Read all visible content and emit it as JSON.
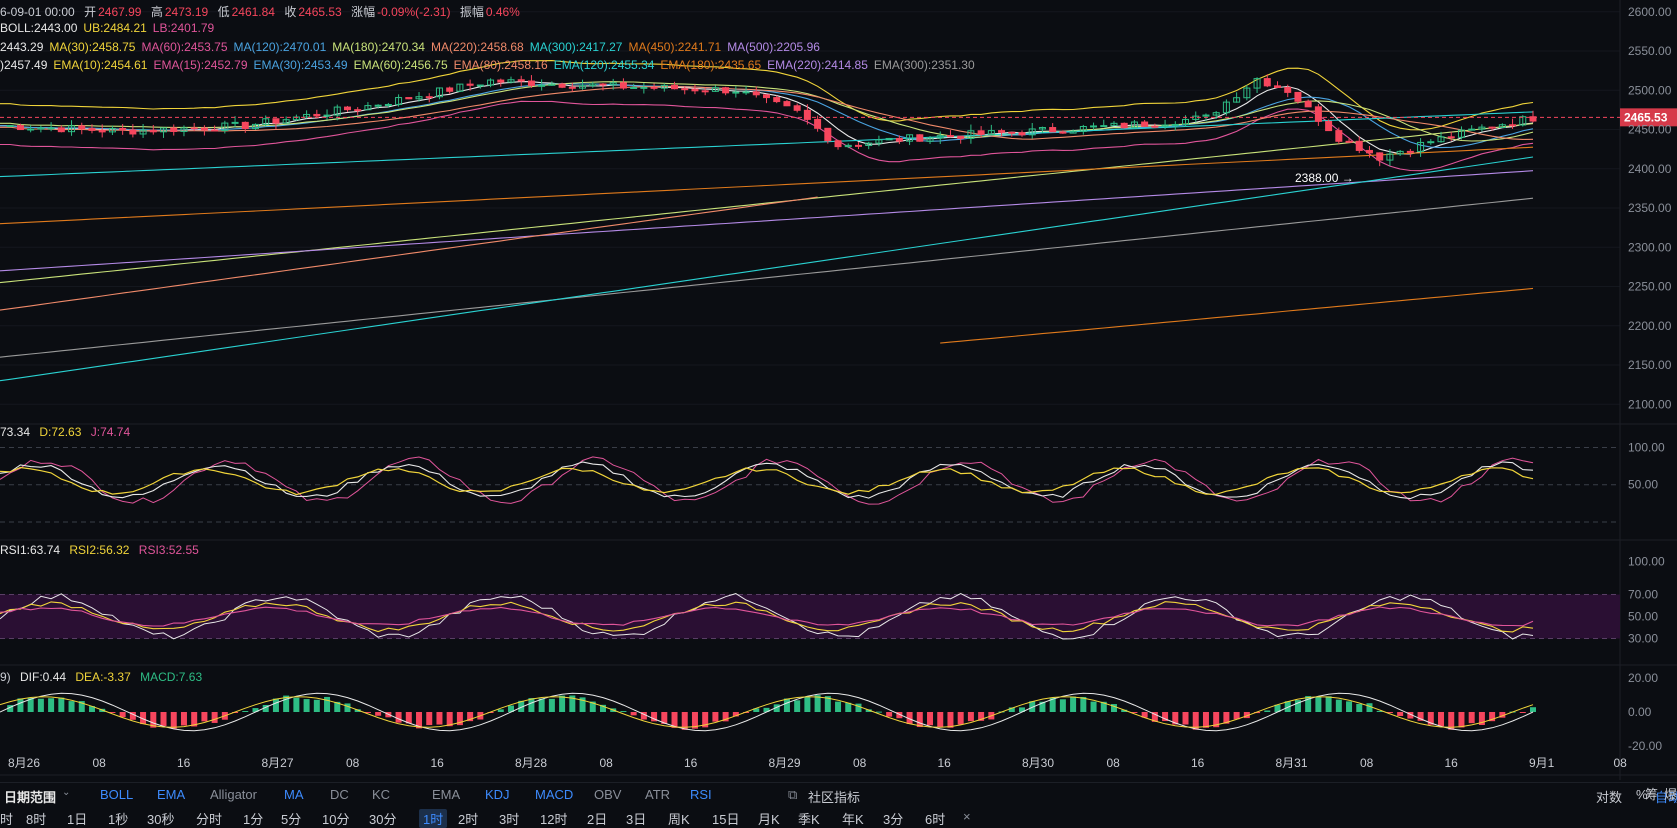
{
  "header": {
    "date": "6-09-01 00:00",
    "open_label": "开",
    "open": "2467.99",
    "high_label": "高",
    "high": "2473.19",
    "low_label": "低",
    "low": "2461.84",
    "close_label": "收",
    "close": "2465.53",
    "change_label": "涨幅",
    "change": "-0.09%(-2.31)",
    "amp_label": "振幅",
    "amp": "0.46%"
  },
  "boll_line": [
    {
      "text": "BOLL:2443.00",
      "color": "#e8e8e8"
    },
    {
      "text": "UB:2484.21",
      "color": "#f0d43a"
    },
    {
      "text": "LB:2401.79",
      "color": "#e0559a"
    }
  ],
  "ma_line": [
    {
      "text": "2443.29",
      "color": "#e8e8e8"
    },
    {
      "text": "MA(30):2458.75",
      "color": "#f0d43a"
    },
    {
      "text": "MA(60):2453.75",
      "color": "#e0559a"
    },
    {
      "text": "MA(120):2470.01",
      "color": "#4aa3e0"
    },
    {
      "text": "MA(180):2470.34",
      "color": "#c9e27a"
    },
    {
      "text": "MA(220):2458.68",
      "color": "#f08a6a"
    },
    {
      "text": "MA(300):2417.27",
      "color": "#2ad1d1"
    },
    {
      "text": "MA(450):2241.71",
      "color": "#e07a1c"
    },
    {
      "text": "MA(500):2205.96",
      "color": "#b48ae6"
    }
  ],
  "ema_line": [
    {
      "text": ")2457.49",
      "color": "#e8e8e8"
    },
    {
      "text": "EMA(10):2454.61",
      "color": "#f0d43a"
    },
    {
      "text": "EMA(15):2452.79",
      "color": "#e0559a"
    },
    {
      "text": "EMA(30):2453.49",
      "color": "#4aa3e0"
    },
    {
      "text": "EMA(60):2456.75",
      "color": "#c9e27a"
    },
    {
      "text": "EMA(80):2458.16",
      "color": "#f08a6a"
    },
    {
      "text": "EMA(120):2455.34",
      "color": "#2ad1d1"
    },
    {
      "text": "EMA(180):2435.65",
      "color": "#e07a1c"
    },
    {
      "text": "EMA(220):2414.85",
      "color": "#b48ae6"
    },
    {
      "text": "EMA(300):2351.30",
      "color": "#9a9a9a"
    }
  ],
  "chart_data": {
    "type": "candlestick",
    "x_ticks": [
      "8月26",
      "08",
      "16",
      "8月27",
      "08",
      "16",
      "8月28",
      "08",
      "16",
      "8月29",
      "08",
      "16",
      "8月30",
      "08",
      "16",
      "8月31",
      "08",
      "16",
      "9月1",
      "08"
    ],
    "price_axis": [
      "2600.00",
      "2550.00",
      "2500.00",
      "2450.00",
      "2400.00",
      "2350.00",
      "2300.00",
      "2250.00",
      "2200.00",
      "2150.00",
      "2100.00"
    ],
    "price_range": [
      2080,
      2615
    ],
    "last_price": "2465.53",
    "low_marker": "2388.00",
    "kdj": {
      "label_k": "73.34",
      "label_d": "D:72.63",
      "label_j": "J:74.74",
      "axis": [
        "100.00",
        "50.00"
      ]
    },
    "rsi": {
      "label_1": "RSI1:63.74",
      "label_2": "RSI2:56.32",
      "label_3": "RSI3:52.55",
      "axis": [
        "100.00",
        "70.00",
        "50.00",
        "30.00"
      ]
    },
    "macd": {
      "label_p": "9)",
      "label_dif": "DIF:0.44",
      "label_dea": "DEA:-3.37",
      "label_macd": "MACD:7.63",
      "axis": [
        "20.00",
        "0.00",
        "-20.00"
      ]
    }
  },
  "indicator_bar": {
    "date_range": "日期范围",
    "main": [
      "BOLL",
      "EMA",
      "Alligator",
      "MA",
      "DC",
      "KC"
    ],
    "sub": [
      "EMA",
      "KDJ",
      "MACD",
      "OBV",
      "ATR",
      "RSI"
    ],
    "community": "社区指标",
    "right": [
      "对数",
      "%",
      "自动"
    ]
  },
  "interval_bar": {
    "items": [
      "时",
      "8时",
      "1日",
      "1秒",
      "30秒",
      "分时",
      "1分",
      "5分",
      "10分",
      "30分",
      "1时",
      "2时",
      "3时",
      "12时",
      "2日",
      "3日",
      "周K",
      "15日",
      "月K",
      "季K",
      "年K",
      "3分",
      "6时"
    ],
    "active": "1时",
    "close": "×"
  },
  "right_edge": [
    "筹",
    "爆"
  ],
  "colors": {
    "up": "#2ebd85",
    "down": "#f6465d",
    "accent": "#3d8bfd",
    "yellow": "#f0d43a",
    "pink": "#e0559a",
    "bg": "#0b0d12"
  }
}
